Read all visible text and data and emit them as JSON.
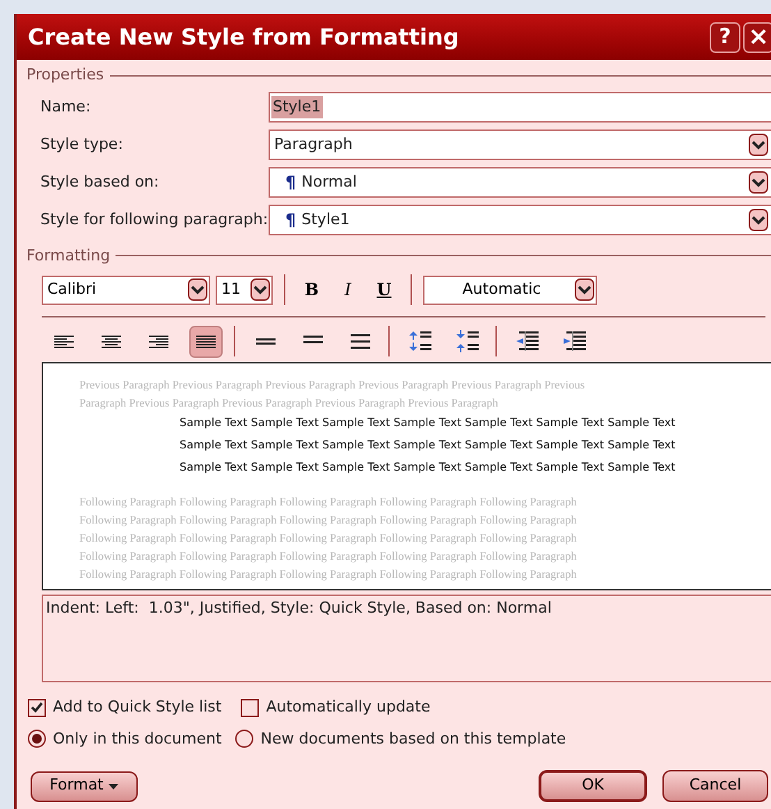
{
  "window": {
    "title": "Create New Style from Formatting",
    "help_button": "?",
    "close_button": "×"
  },
  "properties": {
    "legend": "Properties",
    "fields": [
      {
        "label": "Name:",
        "value": "Style1",
        "kind": "text"
      },
      {
        "label": "Style type:",
        "value": "Paragraph",
        "kind": "select"
      },
      {
        "label": "Style based on:",
        "value": "Normal",
        "kind": "style-select",
        "mark": "¶"
      },
      {
        "label": "Style for following paragraph:",
        "value": "Style1",
        "kind": "style-select",
        "mark": "¶"
      }
    ]
  },
  "formatting": {
    "legend": "Formatting",
    "font": "Calibri",
    "size": "11",
    "bold": "B",
    "italic": "I",
    "underline": "U",
    "font_color": "Automatic",
    "alignment": [
      {
        "kind": "left",
        "selected": false
      },
      {
        "kind": "center",
        "selected": false
      },
      {
        "kind": "right",
        "selected": false
      },
      {
        "kind": "justify",
        "selected": true
      }
    ],
    "spacing": [
      {
        "kind": "single"
      },
      {
        "kind": "one-half"
      },
      {
        "kind": "double"
      },
      {
        "kind": "space-up"
      },
      {
        "kind": "space-down"
      },
      {
        "kind": "indent-decrease"
      },
      {
        "kind": "indent-increase"
      }
    ],
    "preview": {
      "previous": [
        "Previous Paragraph Previous Paragraph Previous Paragraph Previous Paragraph Previous Paragraph Previous",
        "Paragraph Previous Paragraph Previous Paragraph Previous Paragraph Previous Paragraph"
      ],
      "sample": [
        "Sample Text Sample Text Sample Text Sample Text Sample Text Sample Text Sample Text",
        "Sample Text Sample Text Sample Text Sample Text Sample Text Sample Text Sample Text",
        "Sample Text Sample Text Sample Text Sample Text Sample Text Sample Text Sample Text"
      ],
      "following": [
        "Following Paragraph Following Paragraph Following Paragraph Following Paragraph Following Paragraph",
        "Following Paragraph Following Paragraph Following Paragraph Following Paragraph Following Paragraph",
        "Following Paragraph Following Paragraph Following Paragraph Following Paragraph Following Paragraph",
        "Following Paragraph Following Paragraph Following Paragraph Following Paragraph Following Paragraph",
        "Following Paragraph Following Paragraph Following Paragraph Following Paragraph Following Paragraph"
      ]
    },
    "description": "Indent: Left:  1.03\", Justified, Style: Quick Style, Based on: Normal"
  },
  "options": [
    {
      "label": "Add to Quick Style list",
      "kind": "checkbox",
      "checked": true
    },
    {
      "label": "Automatically update",
      "kind": "checkbox",
      "checked": false
    }
  ],
  "scope": [
    {
      "label": "Only in this document",
      "selected": true
    },
    {
      "label": "New documents based on this template",
      "selected": false
    }
  ],
  "buttons": {
    "format": "Format",
    "ok": "OK",
    "cancel": "Cancel"
  }
}
